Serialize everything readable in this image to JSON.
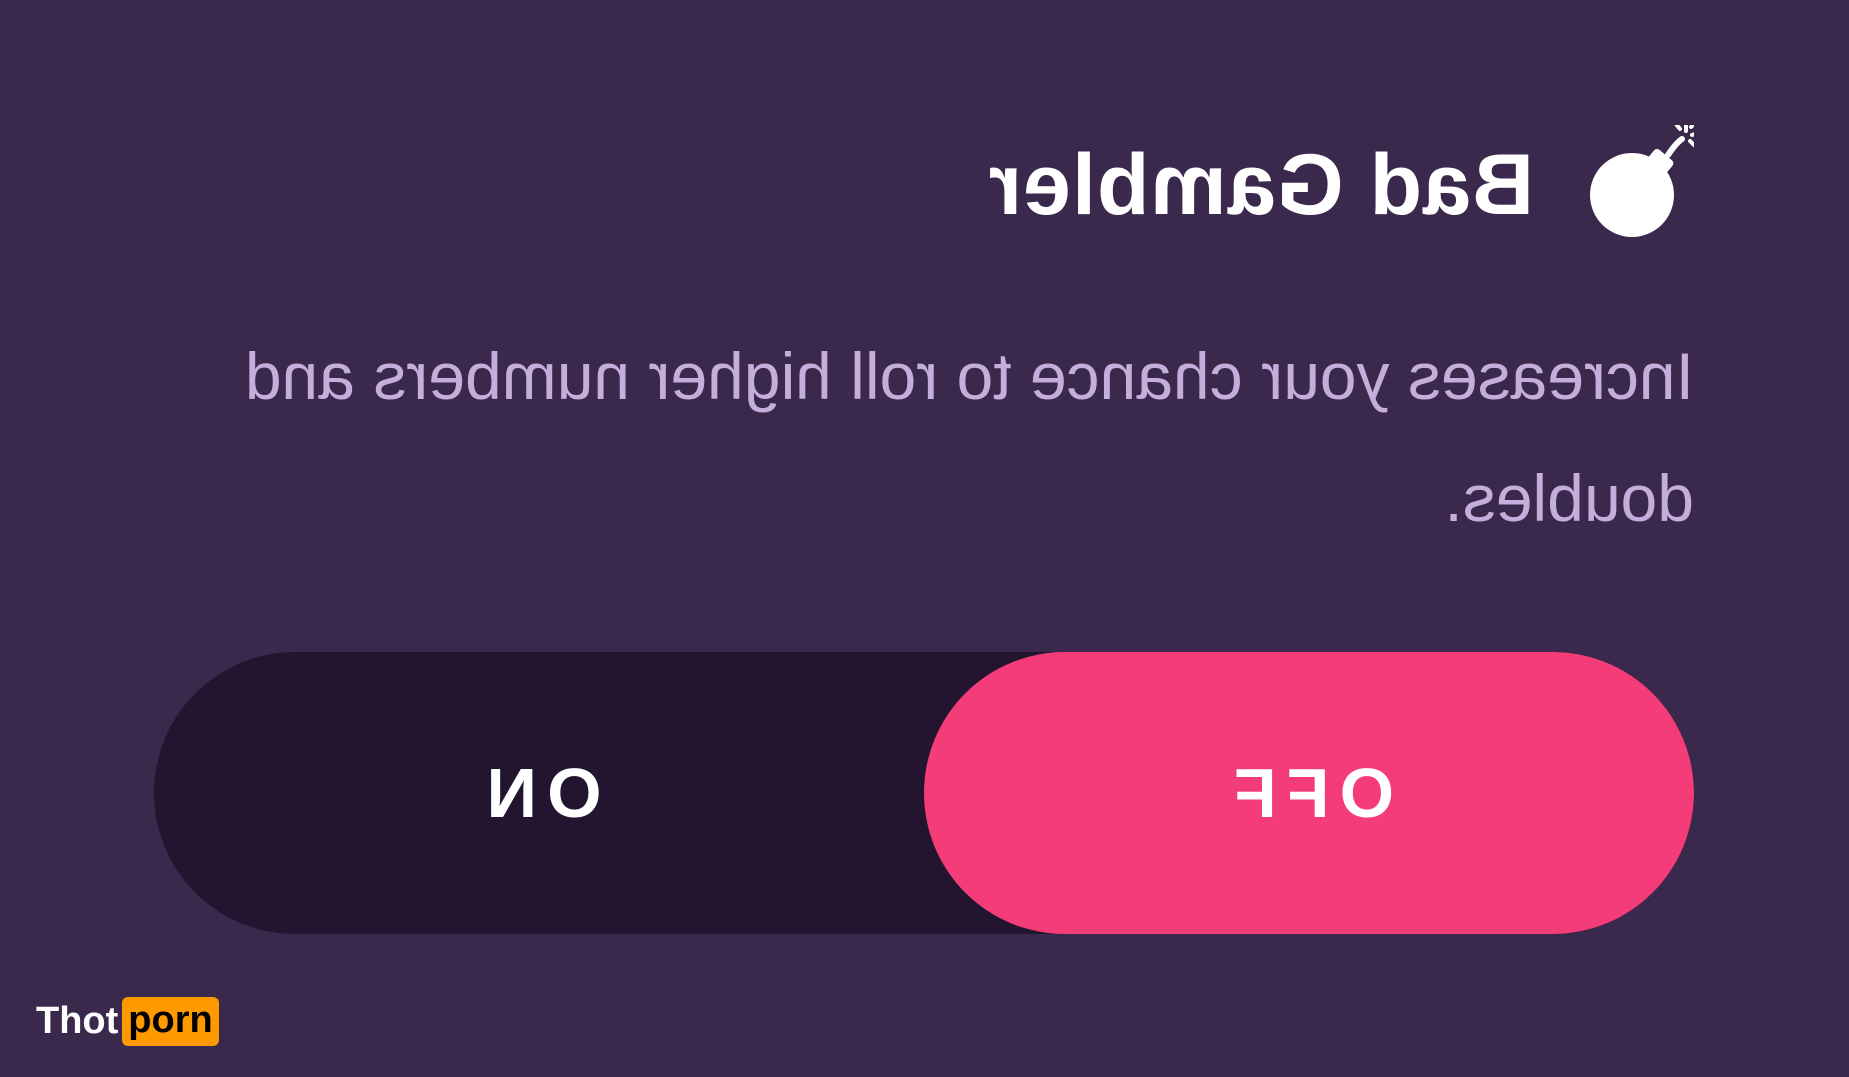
{
  "card": {
    "title": "Bad Gambler",
    "icon": "bomb-icon",
    "description": "Increases your chance to roll higher numbers and doubles."
  },
  "toggle": {
    "off_label": "OFF",
    "on_label": "ON",
    "selected": "OFF"
  },
  "colors": {
    "background": "#3a284d",
    "toggle_track": "#231530",
    "toggle_active": "#f43d78",
    "title": "#ffffff",
    "description": "#c5aedb"
  },
  "watermark": {
    "part1": "Thot",
    "part2": "porn"
  }
}
